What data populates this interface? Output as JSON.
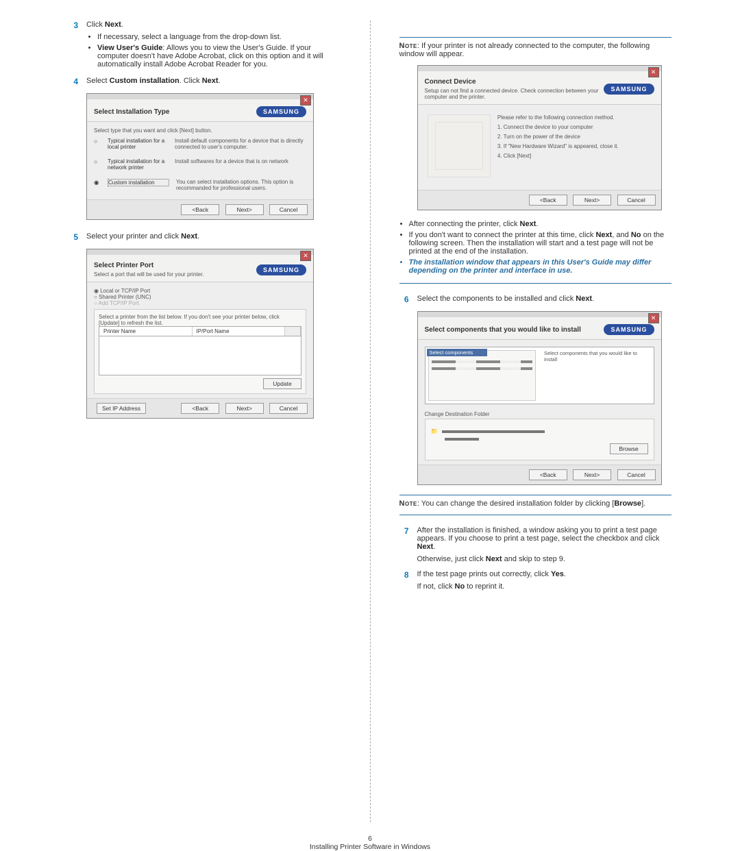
{
  "brand": "SAMSUNG",
  "left": {
    "s3": {
      "num": "3",
      "intro_a": "Click ",
      "intro_b": "Next",
      "intro_c": "."
    },
    "s3_bullets": [
      "If necessary, select a language from the drop-down list.",
      "View User's Guide: Allows you to view the User's Guide. If your computer doesn't have Adobe Acrobat, click on this option and it will automatically install Adobe Acrobat Reader for you."
    ],
    "b2_label": "View User's Guide",
    "s4": {
      "num": "4",
      "a": "Select ",
      "b": "Custom installation",
      "c": ". Click ",
      "d": "Next",
      "e": "."
    },
    "dlg1": {
      "title": "Select Installation Type",
      "sub": "Select type that you want and click [Next] button.",
      "opts": [
        {
          "label": "Typical installation for a local printer",
          "desc": "Install default components for a device that is directly connected to user's computer."
        },
        {
          "label": "Typical installation for a network printer",
          "desc": "Install softwares for a device that is on network"
        },
        {
          "label": "Custom installation",
          "desc": "You can select installation options. This option is recommanded for professional users."
        }
      ],
      "btns": [
        "<Back",
        "Next>",
        "Cancel"
      ]
    },
    "s5": {
      "num": "5",
      "a": "Select your printer and click ",
      "b": "Next",
      "c": "."
    },
    "dlg2": {
      "title": "Select Printer Port",
      "sub": "Select a port that will be used for your printer.",
      "radios": [
        "Local or TCP/IP Port",
        "Shared Printer (UNC)",
        "Add TCP/IP Port."
      ],
      "hint": "Select a printer from the list below. If you don't see your printer below, click [Update] to refresh the list.",
      "cols": [
        "Printer Name",
        "IP/Port Name"
      ],
      "update": "Update",
      "setip": "Set IP Address",
      "btns": [
        "<Back",
        "Next>",
        "Cancel"
      ]
    }
  },
  "right": {
    "note1_a": "Note",
    "note1_b": ": If your printer is not already connected to the computer, the following window will appear.",
    "dlg3": {
      "title": "Connect Device",
      "sub": "Setup can not find a connected device. Check connection between your computer and the printer.",
      "lead": "Please refer to the following connection method.",
      "steps": [
        "1. Connect the device to your computer",
        "2. Turn on the power of the device",
        "3. If \"New Hardware Wizard\" is appeared, close it.",
        "4. Click [Next]"
      ],
      "btns": [
        "<Back",
        "Next>",
        "Cancel"
      ]
    },
    "after": [
      "After connecting the printer, click Next.",
      "If you don't want to connect the printer at this time, click Next, and No on the following screen. Then the installation will start and a test page will not be printed at the end of the installation."
    ],
    "after_b1": "Next",
    "after_b2a": "Next",
    "after_b2b": "No",
    "italic": "The installation window that appears in this User's Guide may differ depending on the printer and interface in use.",
    "s6": {
      "num": "6",
      "a": "Select the components to be installed and click ",
      "b": "Next",
      "c": "."
    },
    "dlg4": {
      "title": "Select components that you would like to install",
      "group_left": "Select components",
      "group_right": "Select components that you would like to install",
      "dest": "Change Destination Folder",
      "browse": "Browse",
      "btns": [
        "<Back",
        "Next>",
        "Cancel"
      ]
    },
    "note2_a": "Note",
    "note2_b": ": You can change the desired installation folder by clicking [",
    "note2_c": "Browse",
    "note2_d": "].",
    "s7": {
      "num": "7",
      "p1a": "After the installation is finished, a window asking you to print a test page appears. If you choose to print a test page, select the checkbox and click ",
      "p1b": "Next",
      "p1c": ".",
      "p2a": "Otherwise, just click ",
      "p2b": "Next",
      "p2c": " and skip to step 9."
    },
    "s8": {
      "num": "8",
      "p1a": "If the test page prints out correctly, click ",
      "p1b": "Yes",
      "p1c": ".",
      "p2a": "If not, click ",
      "p2b": "No",
      "p2c": " to reprint it."
    }
  },
  "footer": {
    "pagenum": "6",
    "title": "Installing Printer Software in Windows"
  }
}
